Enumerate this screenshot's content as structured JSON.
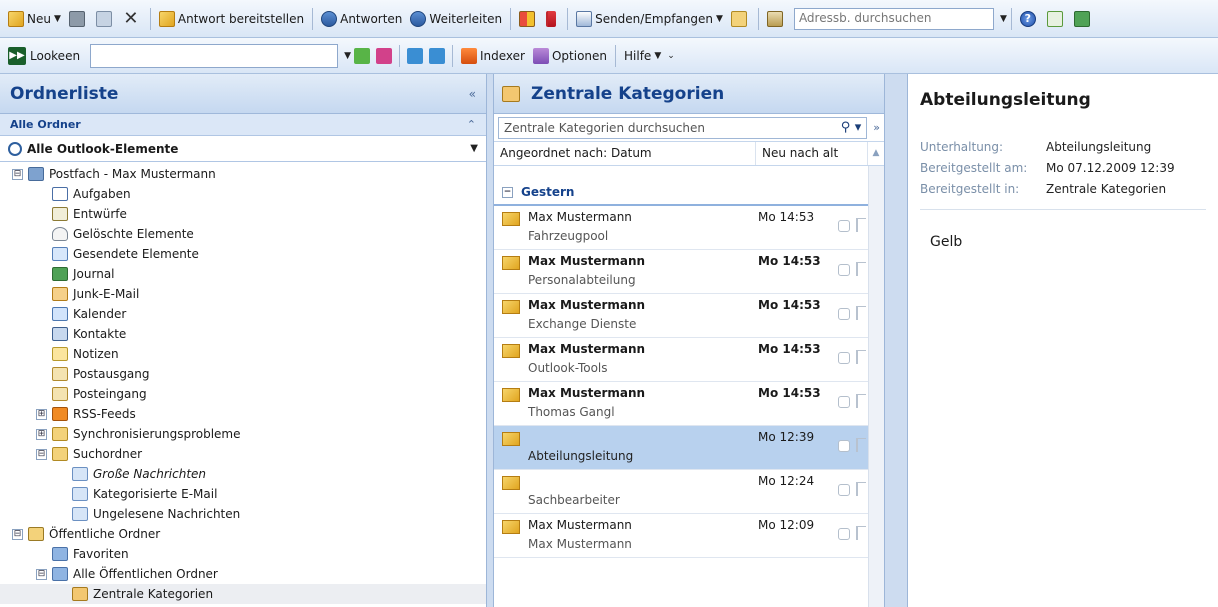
{
  "toolbar1": {
    "new": "Neu",
    "reply_post": "Antwort bereitstellen",
    "reply": "Antworten",
    "forward": "Weiterleiten",
    "send_receive": "Senden/Empfangen",
    "address_search": "Adressb. durchsuchen"
  },
  "toolbar2": {
    "lookeen": "Lookeen",
    "indexer": "Indexer",
    "options": "Optionen",
    "help": "Hilfe"
  },
  "nav": {
    "title": "Ordnerliste",
    "all_folders": "Alle Ordner",
    "all_outlook_items": "Alle Outlook-Elemente",
    "tree": [
      {
        "label": "Postfach - Max Mustermann",
        "toggle": "⊟"
      },
      {
        "label": "Aufgaben"
      },
      {
        "label": "Entwürfe"
      },
      {
        "label": "Gelöschte Elemente"
      },
      {
        "label": "Gesendete Elemente"
      },
      {
        "label": "Journal"
      },
      {
        "label": "Junk-E-Mail"
      },
      {
        "label": "Kalender"
      },
      {
        "label": "Kontakte"
      },
      {
        "label": "Notizen"
      },
      {
        "label": "Postausgang"
      },
      {
        "label": "Posteingang"
      },
      {
        "label": "RSS-Feeds",
        "toggle": "⊞"
      },
      {
        "label": "Synchronisierungsprobleme",
        "toggle": "⊞"
      },
      {
        "label": "Suchordner",
        "toggle": "⊟"
      },
      {
        "label": "Große Nachrichten"
      },
      {
        "label": "Kategorisierte E-Mail"
      },
      {
        "label": "Ungelesene Nachrichten"
      },
      {
        "label": "Öffentliche Ordner",
        "toggle": "⊟"
      },
      {
        "label": "Favoriten"
      },
      {
        "label": "Alle Öffentlichen Ordner",
        "toggle": "⊟"
      },
      {
        "label": "Zentrale Kategorien"
      }
    ]
  },
  "list": {
    "title": "Zentrale Kategorien",
    "search_placeholder": "Zentrale Kategorien durchsuchen",
    "sort_by": "Angeordnet nach: Datum",
    "sort_order": "Neu nach alt",
    "group": "Gestern",
    "messages": [
      {
        "from": "Max Mustermann",
        "subject": "Fahrzeugpool",
        "time": "Mo 14:53"
      },
      {
        "from": "Max Mustermann",
        "subject": "Personalabteilung",
        "time": "Mo 14:53"
      },
      {
        "from": "Max Mustermann",
        "subject": "Exchange Dienste",
        "time": "Mo 14:53"
      },
      {
        "from": "Max Mustermann",
        "subject": "Outlook-Tools",
        "time": "Mo 14:53"
      },
      {
        "from": "Max Mustermann",
        "subject": "Thomas Gangl",
        "time": "Mo 14:53"
      },
      {
        "from": "",
        "subject": "Abteilungsleitung",
        "time": "Mo 12:39"
      },
      {
        "from": "",
        "subject": "Sachbearbeiter",
        "time": "Mo 12:24"
      },
      {
        "from": "Max Mustermann",
        "subject": "Max Mustermann",
        "time": "Mo 12:09"
      }
    ]
  },
  "reading": {
    "title": "Abteilungsleitung",
    "conversation_label": "Unterhaltung:",
    "conversation": "Abteilungsleitung",
    "posted_label": "Bereitgestellt am:",
    "posted": "Mo 07.12.2009 12:39",
    "posted_in_label": "Bereitgestellt in:",
    "posted_in": "Zentrale Kategorien",
    "body": "Gelb"
  },
  "colors": {
    "accent": "#15428b",
    "selection": "#b8d1ee"
  }
}
